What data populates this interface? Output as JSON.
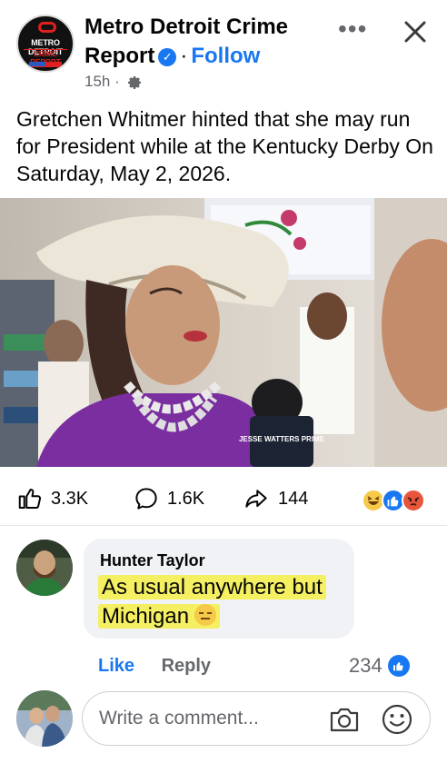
{
  "post": {
    "page_name": "Metro Detroit Crime Report",
    "follow_label": "Follow",
    "time_ago": "15h",
    "text": "Gretchen Whitmer hinted that she may run for President while at the Kentucky Derby On Saturday, May 2, 2026."
  },
  "page_avatar": {
    "line1": "METRO DETROIT",
    "line2": "CRIME REPORT"
  },
  "image": {
    "mic_flag_text": "JESSE WATTERS PRIME"
  },
  "stats": {
    "likes": "3.3K",
    "comments": "1.6K",
    "shares": "144",
    "reaction_icons": [
      "haha-emoji-icon",
      "like-emoji-icon",
      "angry-emoji-icon"
    ]
  },
  "comment": {
    "author": "Hunter Taylor",
    "text": "As usual anywhere but Michigan",
    "emoji": "expressionless-face-icon",
    "like_label": "Like",
    "reply_label": "Reply",
    "like_count": "234"
  },
  "composer": {
    "placeholder": "Write a comment..."
  },
  "colors": {
    "accent": "#1877f2",
    "highlight": "#f5ef62",
    "muted": "#65676b"
  }
}
